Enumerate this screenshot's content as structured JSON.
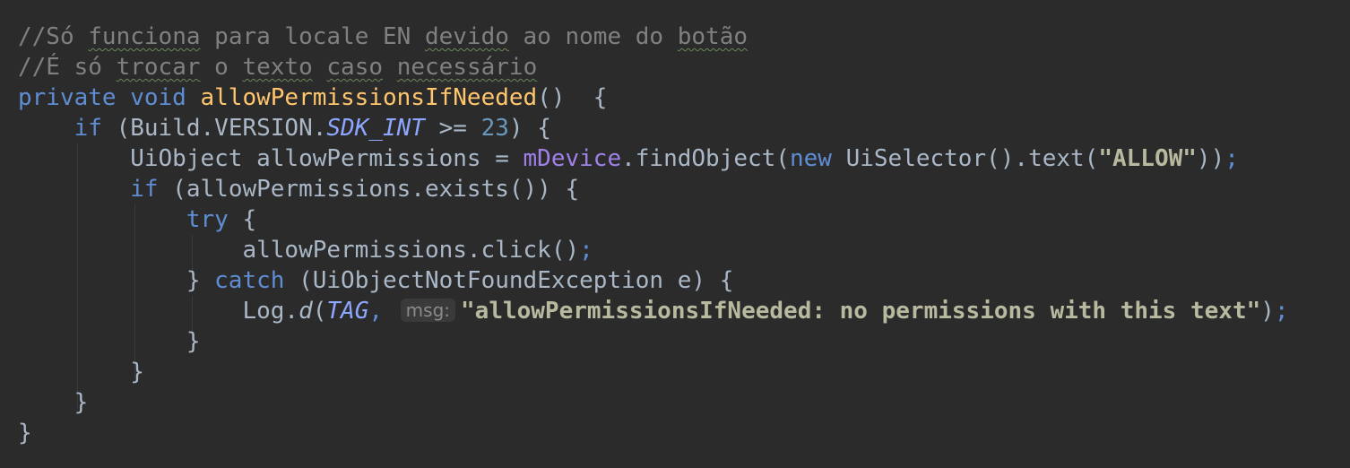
{
  "code": {
    "lines": [
      [
        {
          "text": "//Só ",
          "cls": "comment"
        },
        {
          "text": "funciona",
          "cls": "comment typo"
        },
        {
          "text": " para locale EN ",
          "cls": "comment"
        },
        {
          "text": "devido",
          "cls": "comment typo"
        },
        {
          "text": " ao nome do ",
          "cls": "comment"
        },
        {
          "text": "botão",
          "cls": "comment typo"
        }
      ],
      [
        {
          "text": "//É só ",
          "cls": "comment"
        },
        {
          "text": "trocar",
          "cls": "comment typo"
        },
        {
          "text": " o ",
          "cls": "comment"
        },
        {
          "text": "texto",
          "cls": "comment typo"
        },
        {
          "text": " ",
          "cls": "comment"
        },
        {
          "text": "caso",
          "cls": "comment typo"
        },
        {
          "text": " ",
          "cls": "comment"
        },
        {
          "text": "necessário",
          "cls": "comment typo"
        }
      ],
      [
        {
          "text": "private void ",
          "cls": "keyword"
        },
        {
          "text": "allowPermissionsIfNeeded",
          "cls": "method-decl"
        },
        {
          "text": "()  {",
          "cls": "plain"
        }
      ],
      [
        {
          "text": "    ",
          "cls": "plain"
        },
        {
          "text": "if",
          "cls": "keyword"
        },
        {
          "text": " (Build.VERSION.",
          "cls": "plain"
        },
        {
          "text": "SDK_INT",
          "cls": "static-field"
        },
        {
          "text": " >= ",
          "cls": "plain"
        },
        {
          "text": "23",
          "cls": "number"
        },
        {
          "text": ") {",
          "cls": "plain"
        }
      ],
      [
        {
          "text": "        UiObject allowPermissions = ",
          "cls": "plain"
        },
        {
          "text": "mDevice",
          "cls": "field"
        },
        {
          "text": ".findObject(",
          "cls": "plain"
        },
        {
          "text": "new",
          "cls": "keyword"
        },
        {
          "text": " UiSelector().text(",
          "cls": "plain"
        },
        {
          "text": "\"ALLOW\"",
          "cls": "string"
        },
        {
          "text": "))",
          "cls": "plain"
        },
        {
          "text": ";",
          "cls": "keyword"
        }
      ],
      [
        {
          "text": "        ",
          "cls": "plain"
        },
        {
          "text": "if",
          "cls": "keyword"
        },
        {
          "text": " (allowPermissions.exists()) {",
          "cls": "plain"
        }
      ],
      [
        {
          "text": "            ",
          "cls": "plain"
        },
        {
          "text": "try",
          "cls": "keyword"
        },
        {
          "text": " {",
          "cls": "plain"
        }
      ],
      [
        {
          "text": "                allowPermissions.click()",
          "cls": "plain"
        },
        {
          "text": ";",
          "cls": "keyword"
        }
      ],
      [
        {
          "text": "            } ",
          "cls": "plain"
        },
        {
          "text": "catch",
          "cls": "keyword"
        },
        {
          "text": " (UiObjectNotFoundException e) {",
          "cls": "plain"
        }
      ],
      [
        {
          "text": "                Log.",
          "cls": "plain"
        },
        {
          "text": "d",
          "cls": "plain static-call"
        },
        {
          "text": "(",
          "cls": "plain"
        },
        {
          "text": "TAG",
          "cls": "static-field"
        },
        {
          "text": ",",
          "cls": "keyword"
        },
        {
          "text": " ",
          "cls": "plain"
        },
        {
          "text": "msg:",
          "cls": "hint"
        },
        {
          "text": "\"allowPermissionsIfNeeded: no permissions with this text\"",
          "cls": "string"
        },
        {
          "text": ")",
          "cls": "plain"
        },
        {
          "text": ";",
          "cls": "keyword"
        }
      ],
      [
        {
          "text": "            }",
          "cls": "plain"
        }
      ],
      [
        {
          "text": "        }",
          "cls": "plain"
        }
      ],
      [
        {
          "text": "    }",
          "cls": "plain"
        }
      ],
      [
        {
          "text": "}",
          "cls": "plain"
        }
      ]
    ]
  }
}
